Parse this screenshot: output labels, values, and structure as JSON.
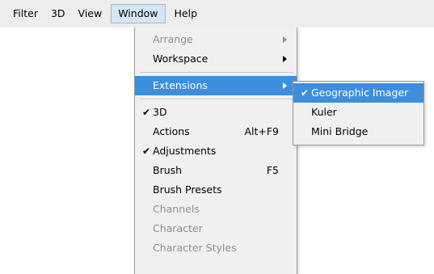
{
  "menubar": {
    "items": [
      {
        "label": "Filter"
      },
      {
        "label": "3D"
      },
      {
        "label": "View"
      },
      {
        "label": "Window"
      },
      {
        "label": "Help"
      }
    ]
  },
  "window_menu": {
    "items": [
      {
        "label": "Arrange",
        "disabled": true,
        "submenu": true
      },
      {
        "label": "Workspace",
        "submenu": true
      },
      {
        "label": "Extensions",
        "submenu": true,
        "highlighted": true
      },
      {
        "label": "3D",
        "checked": true
      },
      {
        "label": "Actions",
        "shortcut": "Alt+F9"
      },
      {
        "label": "Adjustments",
        "checked": true
      },
      {
        "label": "Brush",
        "shortcut": "F5"
      },
      {
        "label": "Brush Presets"
      },
      {
        "label": "Channels",
        "disabled": true
      },
      {
        "label": "Character",
        "disabled": true
      },
      {
        "label": "Character Styles",
        "disabled": true
      }
    ],
    "check_glyph": "✔"
  },
  "extensions_submenu": {
    "items": [
      {
        "label": "Geographic Imager",
        "checked": true,
        "highlighted": true
      },
      {
        "label": "Kuler"
      },
      {
        "label": "Mini Bridge"
      }
    ]
  },
  "colors": {
    "highlight": "#3d8fdc",
    "menubar_bg": "#ededed",
    "menu_bg": "#f0f0f0",
    "disabled_text": "#8f8f8f"
  }
}
